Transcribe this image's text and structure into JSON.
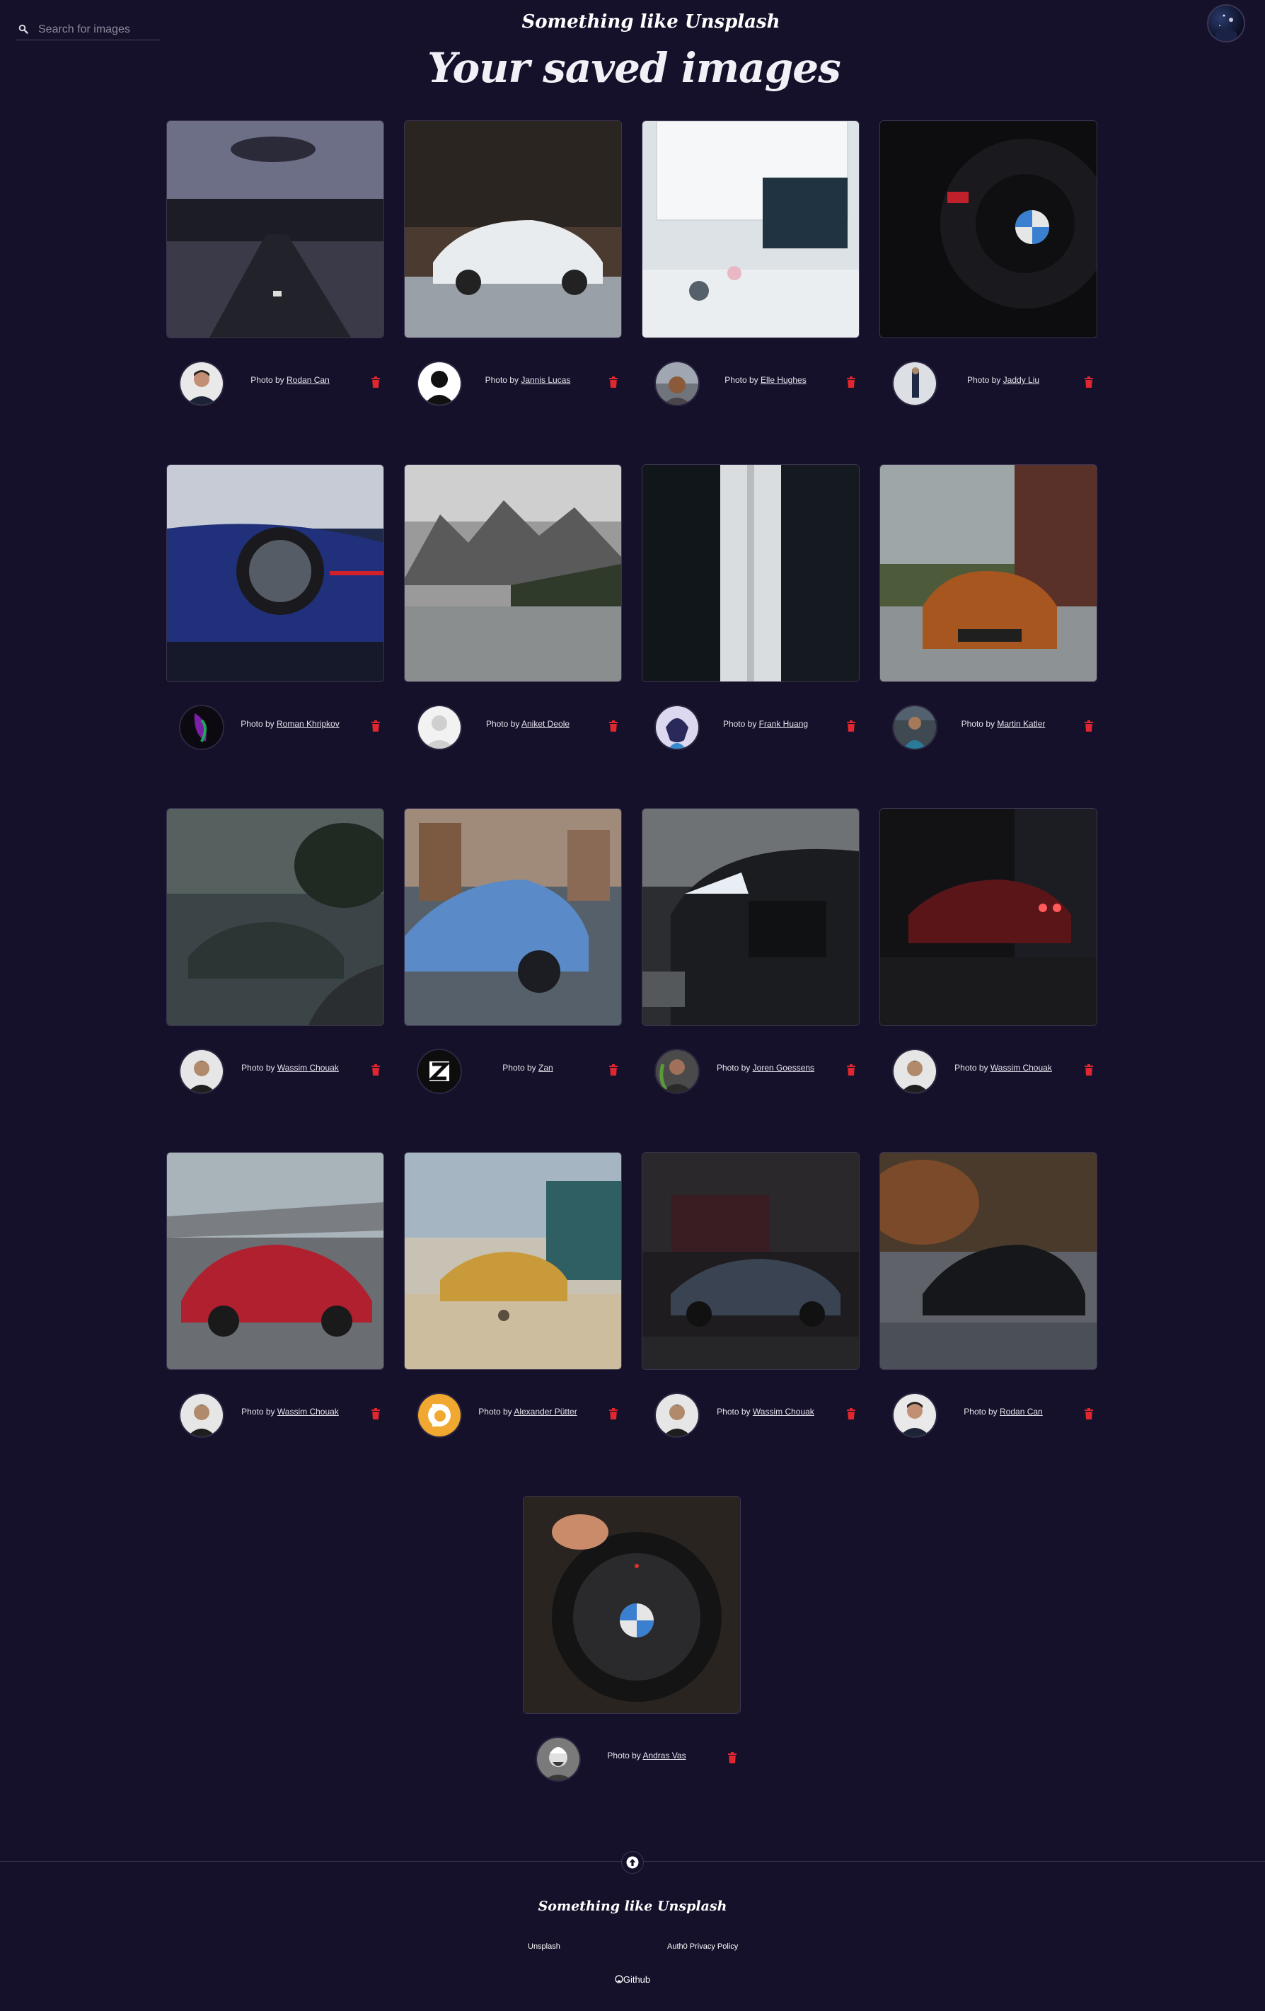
{
  "search": {
    "placeholder": "Search for images",
    "value": ""
  },
  "header": {
    "brand": "Something like Unsplash",
    "title": "Your saved images"
  },
  "images": [
    {
      "label": "Photo by",
      "author": "Rodan Can"
    },
    {
      "label": "Photo by",
      "author": "Jannis Lucas"
    },
    {
      "label": "Photo by",
      "author": "Elle Hughes"
    },
    {
      "label": "Photo by",
      "author": "Jaddy Liu"
    },
    {
      "label": "Photo by",
      "author": "Roman Khripkov"
    },
    {
      "label": "Photo by",
      "author": "Aniket Deole"
    },
    {
      "label": "Photo by",
      "author": "Frank Huang"
    },
    {
      "label": "Photo by",
      "author": "Martin Katler"
    },
    {
      "label": "Photo by",
      "author": "Wassim Chouak"
    },
    {
      "label": "Photo by",
      "author": "Zan"
    },
    {
      "label": "Photo by",
      "author": "Joren Goessens"
    },
    {
      "label": "Photo by",
      "author": "Wassim Chouak"
    },
    {
      "label": "Photo by",
      "author": "Wassim Chouak"
    },
    {
      "label": "Photo by",
      "author": "Alexander Pütter"
    },
    {
      "label": "Photo by",
      "author": "Wassim Chouak"
    },
    {
      "label": "Photo by",
      "author": "Rodan Can"
    },
    {
      "label": "Photo by",
      "author": "Andras Vas"
    }
  ],
  "footer": {
    "brand": "Something like Unsplash",
    "link_unsplash": "Unsplash",
    "link_privacy": "Auth0 Privacy Policy",
    "github": "Github"
  },
  "colors": {
    "background": "#16112a",
    "delete": "#e0262e"
  }
}
